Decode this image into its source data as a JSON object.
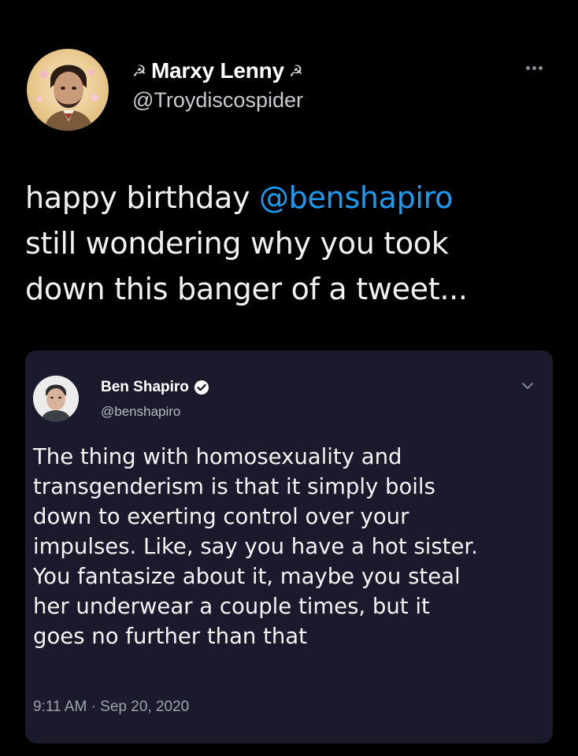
{
  "author": {
    "name": "Marxy Lenny",
    "name_prefix_emoji": "☭",
    "name_suffix_emoji": "☭",
    "handle": "@Troydiscospider",
    "avatar_icon": "portrait-avatar"
  },
  "more_icon": "ellipsis-icon",
  "tweet": {
    "line1_prefix": "happy birthday ",
    "line1_mention": "@benshapiro",
    "line2": "still wondering why you took",
    "line3": "down this banger of a tweet..."
  },
  "quoted": {
    "name": "Ben Shapiro",
    "handle": "@benshapiro",
    "verified_icon": "verified-badge-icon",
    "chevron_icon": "chevron-down-icon",
    "lines": [
      "The thing with homosexuality and",
      "transgenderism is that it simply boils",
      "down to exerting control over your",
      "impulses. Like, say you have a hot sister.",
      "You fantasize about it, maybe you steal",
      "her underwear a couple times, but it",
      "goes no further than that"
    ],
    "timestamp": "9:11 AM · Sep 20, 2020"
  },
  "colors": {
    "background": "#000000",
    "mention": "#1d9bf0",
    "quoted_background": "#1a1a2c",
    "verified": "#1d9bf0"
  }
}
